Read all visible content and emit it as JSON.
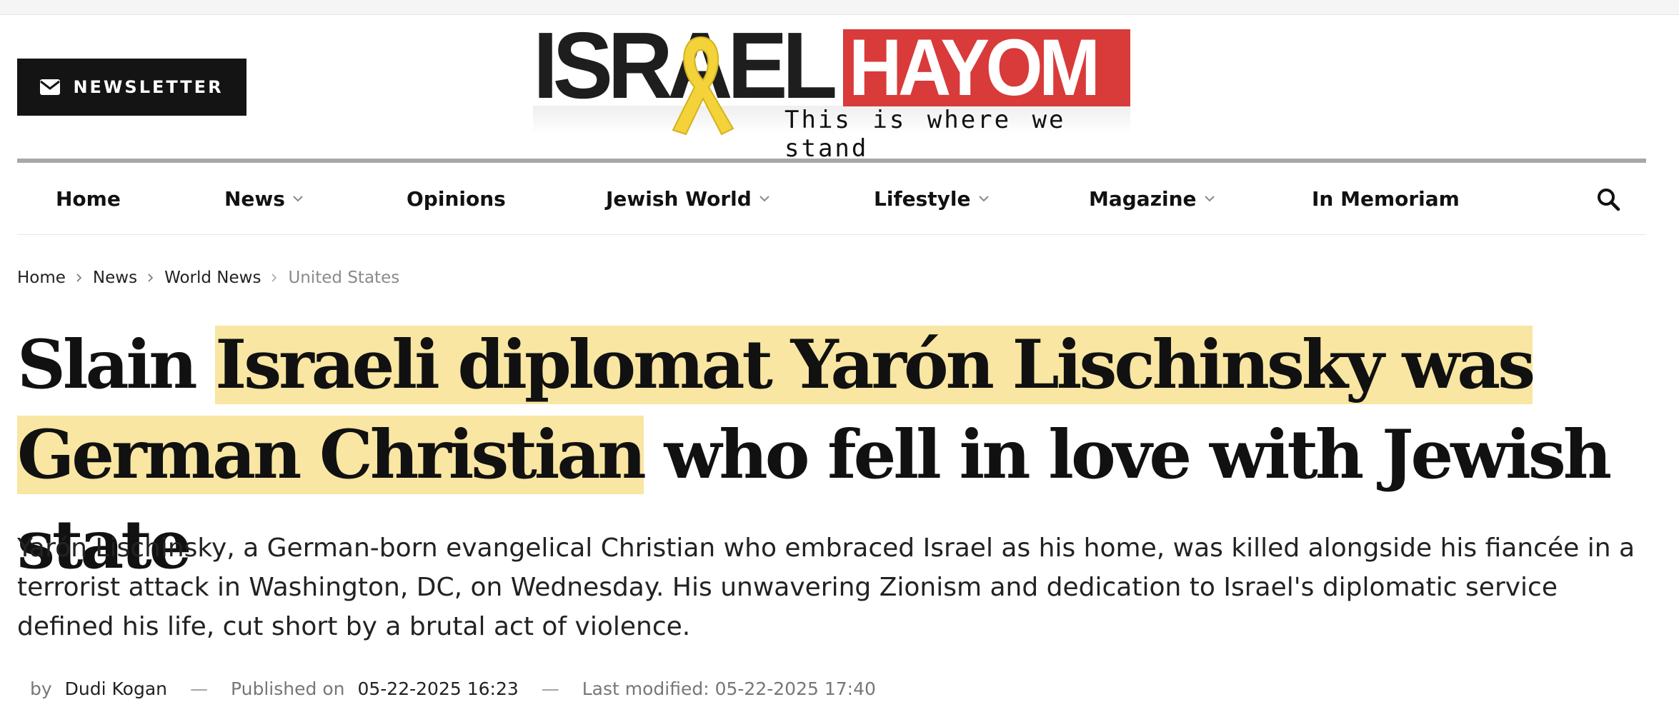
{
  "header": {
    "newsletter_label": "NEWSLETTER",
    "logo": {
      "israel_text": "ISRAEL",
      "hayom_text": "HAYOM",
      "tagline": "This is where we stand",
      "brand_red": "#d93a3a",
      "ribbon_color": "#f3d23a"
    }
  },
  "nav": {
    "items": [
      {
        "label": "Home",
        "has_dropdown": false
      },
      {
        "label": "News",
        "has_dropdown": true
      },
      {
        "label": "Opinions",
        "has_dropdown": false
      },
      {
        "label": "Jewish World",
        "has_dropdown": true
      },
      {
        "label": "Lifestyle",
        "has_dropdown": true
      },
      {
        "label": "Magazine",
        "has_dropdown": true
      },
      {
        "label": "In Memoriam",
        "has_dropdown": false
      }
    ],
    "search_icon": "search-icon"
  },
  "breadcrumb": {
    "items": [
      "Home",
      "News",
      "World News"
    ],
    "current": "United States"
  },
  "article": {
    "headline": {
      "part1": "Slain ",
      "part2_highlight": "Israeli diplomat Yarón Lischinsky was",
      "part3_highlight": "German Christian",
      "part4": " who fell in love with Jewish state",
      "highlight_color": "#f8e6a2"
    },
    "subtitle": "Yarón Lischinsky, a German-born evangelical Christian who embraced Israel as his home, was killed alongside his fiancée in a terrorist attack in Washington, DC, on Wednesday. His unwavering Zionism and dedication to Israel's diplomatic service defined his life, cut short by a brutal act of violence.",
    "meta": {
      "by_label": "by",
      "author": "Dudi Kogan",
      "separator": "—",
      "published_label": "Published on",
      "published_date": "05-22-2025 16:23",
      "modified_text": "Last modified: 05-22-2025 17:40"
    }
  }
}
